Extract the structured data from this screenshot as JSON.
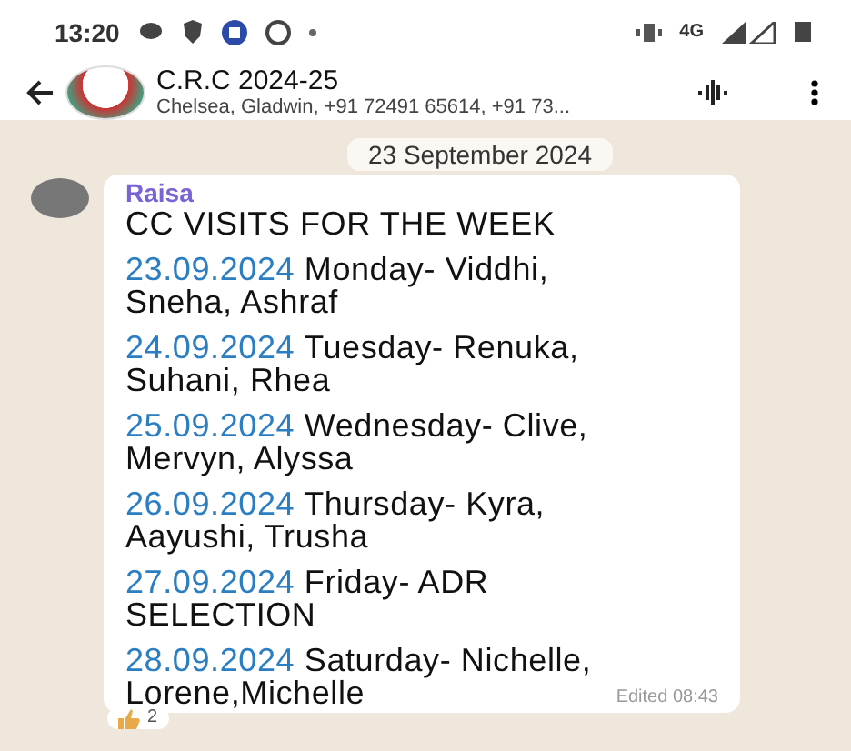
{
  "status_bar": {
    "time": "13:20",
    "network": "4G"
  },
  "header": {
    "title": "C.R.C 2024-25",
    "subtitle": "Chelsea, Gladwin, +91 72491 65614, +91 73..."
  },
  "date_chip": "23 September 2024",
  "message": {
    "sender": "Raisa",
    "title": "CC VISITS FOR THE WEEK",
    "entries": [
      {
        "date": "23.09.2024",
        "text": " Monday- Viddhi, Sneha, Ashraf"
      },
      {
        "date": "24.09.2024",
        "text": " Tuesday- Renuka, Suhani, Rhea"
      },
      {
        "date": "25.09.2024",
        "text": " Wednesday- Clive, Mervyn, Alyssa"
      },
      {
        "date": "26.09.2024",
        "text": " Thursday- Kyra, Aayushi, Trusha"
      },
      {
        "date": "27.09.2024",
        "text": " Friday- ADR SELECTION"
      },
      {
        "date": "28.09.2024",
        "text": " Saturday- Nichelle, Lorene,Michelle"
      }
    ],
    "edited": "Edited 08:43",
    "reaction_count": "2"
  }
}
